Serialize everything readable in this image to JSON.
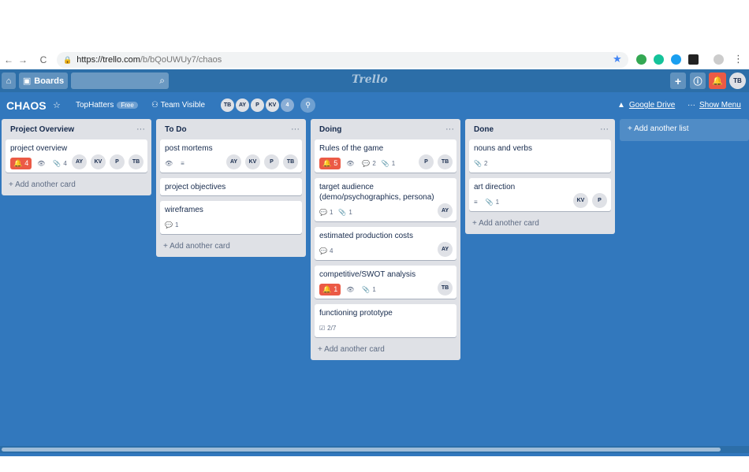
{
  "browser": {
    "url_host": "https://trello.com",
    "url_path": "/b/bQoUWUy7/chaos",
    "back_icon": "←",
    "forward_icon": "→",
    "reload_icon": "C"
  },
  "header": {
    "boards_label": "Boards",
    "logo": "Trello",
    "user_initials": "TB"
  },
  "board": {
    "title": "CHAOS",
    "team": "TopHatters",
    "plan": "Free",
    "visibility": "Team Visible",
    "members": [
      "TB",
      "AY",
      "P",
      "KV",
      "4"
    ],
    "google_drive": "Google Drive",
    "show_menu": "Show Menu",
    "add_list": "+ Add another list"
  },
  "lists": [
    {
      "title": "Project Overview",
      "add_card": "+ Add another card",
      "cards": [
        {
          "title": "project overview",
          "due": "4",
          "watch": true,
          "attach": "4",
          "members": [
            "AY",
            "KV",
            "P",
            "TB"
          ]
        }
      ]
    },
    {
      "title": "To Do",
      "add_card": "+ Add another card",
      "cards": [
        {
          "title": "post mortems",
          "watch": true,
          "desc": true,
          "members": [
            "AY",
            "KV",
            "P",
            "TB"
          ]
        },
        {
          "title": "project objectives"
        },
        {
          "title": "wireframes",
          "comments": "1"
        }
      ]
    },
    {
      "title": "Doing",
      "add_card": "+ Add another card",
      "cards": [
        {
          "title": "Rules of the game",
          "due": "5",
          "watch": true,
          "comments": "2",
          "attach": "1",
          "members": [
            "P",
            "TB"
          ]
        },
        {
          "title": "target audience (demo/psychographics, persona)",
          "comments": "1",
          "attach": "1",
          "members": [
            "AY"
          ]
        },
        {
          "title": "estimated production costs",
          "comments": "4",
          "members": [
            "AY"
          ]
        },
        {
          "title": "competitive/SWOT analysis",
          "due": "1",
          "watch": true,
          "attach": "1",
          "members": [
            "TB"
          ]
        },
        {
          "title": "functioning prototype",
          "checklist": "2/7"
        }
      ]
    },
    {
      "title": "Done",
      "add_card": "+ Add another card",
      "cards": [
        {
          "title": "nouns and verbs",
          "attach": "2"
        },
        {
          "title": "art direction",
          "desc": true,
          "attach": "1",
          "members": [
            "KV",
            "P"
          ]
        }
      ]
    }
  ],
  "colors": {
    "board_bg": "#3278bd",
    "header_bg": "#2c6ea8",
    "due_red": "#eb5a46"
  }
}
